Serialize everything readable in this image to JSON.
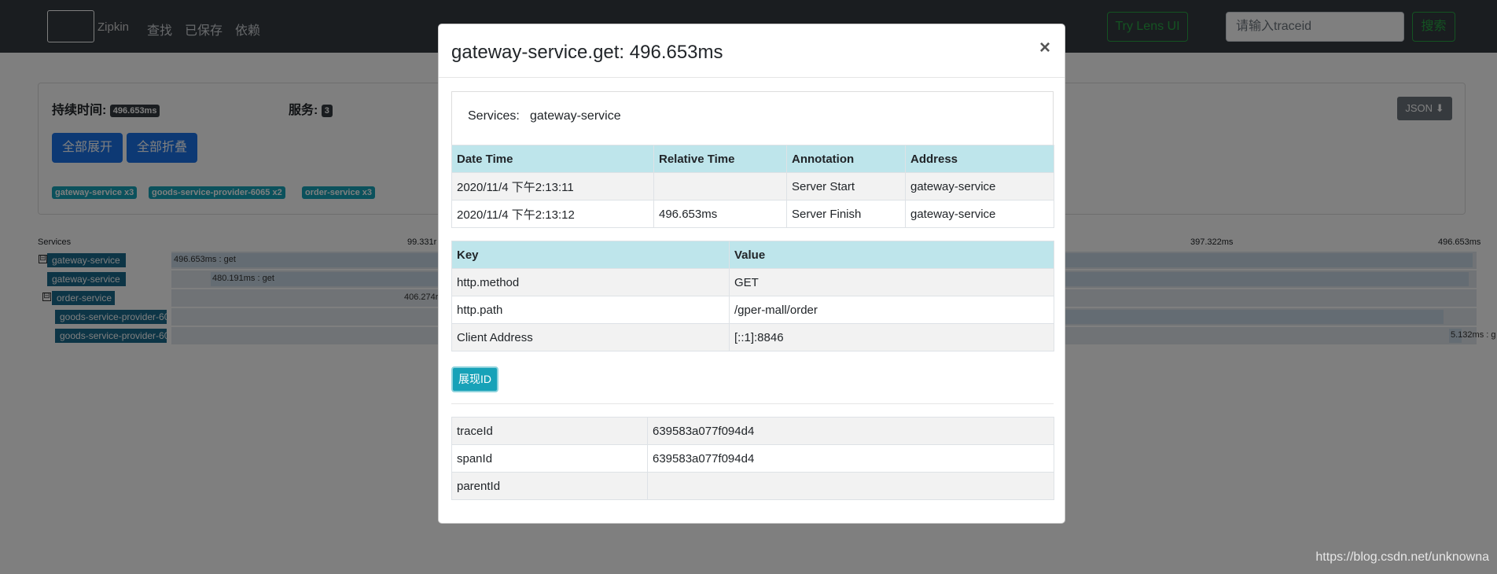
{
  "nav": {
    "brand": "Zipkin",
    "links": [
      "查找",
      "已保存",
      "依赖"
    ],
    "lens_button": "Try Lens UI",
    "search_placeholder": "请输入traceid",
    "search_button": "搜索"
  },
  "summary": {
    "duration_label": "持续时间:",
    "duration_value": "496.653ms",
    "services_label": "服务:",
    "services_count": "3",
    "expand_all": "全部展开",
    "collapse_all": "全部折叠",
    "json_button": "JSON",
    "service_chips": [
      "gateway-service x3",
      "goods-service-provider-6065 x2",
      "order-service x3"
    ]
  },
  "timeline": {
    "services_header": "Services",
    "ticks": [
      "99.331r",
      "397.322ms",
      "496.653ms"
    ],
    "rows": [
      {
        "service": "gateway-service",
        "span": "496.653ms : get",
        "toggle": "⊟"
      },
      {
        "service": "gateway-service",
        "span": "480.191ms : get",
        "toggle": ""
      },
      {
        "service": "order-service",
        "span": "406.274r",
        "toggle": "⊟"
      },
      {
        "service": "goods-service-provider-60",
        "span": "",
        "toggle": ""
      },
      {
        "service": "goods-service-provider-60",
        "span": "5.132ms : g",
        "toggle": ""
      }
    ]
  },
  "modal": {
    "title": "gateway-service.get: 496.653ms",
    "close": "×",
    "services_key": "Services:",
    "services_value": "gateway-service",
    "annotations": {
      "headers": [
        "Date Time",
        "Relative Time",
        "Annotation",
        "Address"
      ],
      "rows": [
        [
          "2020/11/4 下午2:13:11",
          "",
          "Server Start",
          "gateway-service"
        ],
        [
          "2020/11/4 下午2:13:12",
          "496.653ms",
          "Server Finish",
          "gateway-service"
        ]
      ]
    },
    "tags": {
      "headers": [
        "Key",
        "Value"
      ],
      "rows": [
        [
          "http.method",
          "GET"
        ],
        [
          "http.path",
          "/gper-mall/order"
        ],
        [
          "Client Address",
          "[::1]:8846"
        ]
      ]
    },
    "show_id_button": "展现ID",
    "ids": {
      "rows": [
        [
          "traceId",
          "639583a077f094d4"
        ],
        [
          "spanId",
          "639583a077f094d4"
        ],
        [
          "parentId",
          ""
        ]
      ]
    }
  },
  "watermark": "https://blog.csdn.net/unknowna"
}
